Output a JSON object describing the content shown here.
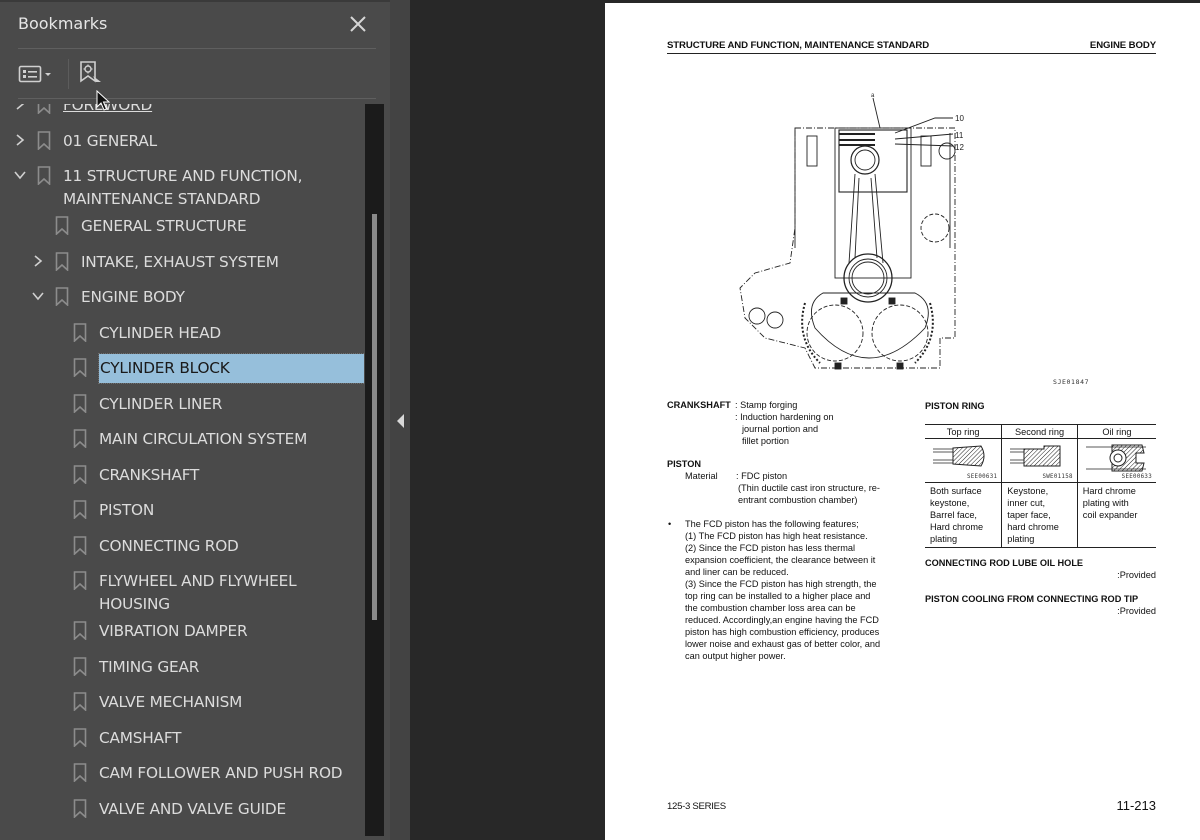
{
  "sidebar": {
    "title": "Bookmarks",
    "close_icon": "close-icon",
    "toolbar": {
      "options_icon": "list-options-icon",
      "options_dropdown_icon": "caret-down-icon",
      "find_current_icon": "find-current-bookmark-icon"
    },
    "bookmarks": [
      {
        "label": "FOREWORD",
        "level": 0,
        "expander": "collapsed",
        "partially_visible": true
      },
      {
        "label": "01 GENERAL",
        "level": 0,
        "expander": "collapsed"
      },
      {
        "label": "11 STRUCTURE AND FUNCTION, MAINTENANCE STANDARD",
        "label_lines": [
          "11 STRUCTURE AND FUNCTION,",
          "MAINTENANCE STANDARD"
        ],
        "level": 0,
        "expander": "expanded"
      },
      {
        "label": "GENERAL STRUCTURE",
        "level": 1,
        "expander": "none"
      },
      {
        "label": "INTAKE, EXHAUST SYSTEM",
        "level": 1,
        "expander": "collapsed"
      },
      {
        "label": "ENGINE BODY",
        "level": 1,
        "expander": "expanded"
      },
      {
        "label": "CYLINDER HEAD",
        "level": 2,
        "expander": "none"
      },
      {
        "label": "CYLINDER BLOCK",
        "level": 2,
        "expander": "none",
        "selected": true
      },
      {
        "label": "CYLINDER LINER",
        "level": 2,
        "expander": "none"
      },
      {
        "label": "MAIN CIRCULATION SYSTEM",
        "level": 2,
        "expander": "none"
      },
      {
        "label": "CRANKSHAFT",
        "level": 2,
        "expander": "none"
      },
      {
        "label": "PISTON",
        "level": 2,
        "expander": "none"
      },
      {
        "label": "CONNECTING ROD",
        "level": 2,
        "expander": "none"
      },
      {
        "label": "FLYWHEEL AND FLYWHEEL HOUSING",
        "label_lines": [
          "FLYWHEEL AND FLYWHEEL",
          "HOUSING"
        ],
        "level": 2,
        "expander": "none"
      },
      {
        "label": "VIBRATION DAMPER",
        "level": 2,
        "expander": "none"
      },
      {
        "label": "TIMING GEAR",
        "level": 2,
        "expander": "none"
      },
      {
        "label": "VALVE MECHANISM",
        "level": 2,
        "expander": "none"
      },
      {
        "label": "CAMSHAFT",
        "level": 2,
        "expander": "none"
      },
      {
        "label": "CAM FOLLOWER AND PUSH ROD",
        "level": 2,
        "expander": "none"
      },
      {
        "label": "VALVE AND VALVE GUIDE",
        "level": 2,
        "expander": "none"
      }
    ],
    "scrollbar": {
      "thumb_start_fraction": 0.15,
      "thumb_size_fraction": 0.555
    },
    "collapse_icon": "collapse-panel-left-icon"
  },
  "page": {
    "header_left": "STRUCTURE AND FUNCTION, MAINTENANCE STANDARD",
    "header_right": "ENGINE BODY",
    "figure": {
      "callouts": [
        "a",
        "10",
        "11",
        "12"
      ],
      "code": "SJE01847"
    },
    "crankshaft": {
      "label": "CRANKSHAFT",
      "lines": [
        ": Stamp forging",
        ": Induction hardening on",
        "journal portion and",
        "fillet portion"
      ]
    },
    "piston": {
      "heading": "PISTON",
      "material_label": "Material",
      "material_value": ": FDC piston",
      "material_note_lines": [
        "(Thin ductile cast iron structure, re-",
        "entrant combustion chamber)"
      ]
    },
    "features": {
      "bullet": "•",
      "lines": [
        "The FCD piston has the following features;",
        "(1) The FCD piston has high heat resistance.",
        "(2) Since the FCD piston has less thermal",
        "expansion coefficient, the clearance between it",
        "and liner can be reduced.",
        "(3) Since the FCD piston has high strength, the",
        "top ring can be installed to a higher place and",
        "the combustion chamber loss area can be",
        "reduced. Accordingly,an engine having the FCD",
        "piston has high combustion efficiency, produces",
        "lower noise and exhaust gas of better color, and",
        "can output higher power."
      ]
    },
    "piston_ring": {
      "title": "PISTON RING",
      "columns": [
        {
          "header": "Top ring",
          "code": "SEE00631",
          "desc_lines": [
            "Both surface",
            "keystone,",
            "Barrel face,",
            "Hard chrome",
            "plating"
          ]
        },
        {
          "header": "Second ring",
          "code": "SWE01158",
          "desc_lines": [
            "Keystone,",
            "inner cut,",
            "taper face,",
            "hard chrome",
            "plating"
          ]
        },
        {
          "header": "Oil ring",
          "code": "SEE00633",
          "desc_lines": [
            "Hard chrome",
            "plating with",
            "coil expander"
          ]
        }
      ]
    },
    "lube_hole": {
      "title": "CONNECTING ROD LUBE OIL HOLE",
      "value": ":Provided"
    },
    "piston_cooling": {
      "title": "PISTON COOLING FROM CONNECTING ROD TIP",
      "value": ":Provided"
    },
    "footer_left": "125-3 SERIES",
    "page_number": "11-213"
  },
  "colors": {
    "sidebar_bg": "#4a4a4a",
    "doc_bg": "#282828",
    "selection": "#96bfdb",
    "text": "#dcdcdc"
  }
}
